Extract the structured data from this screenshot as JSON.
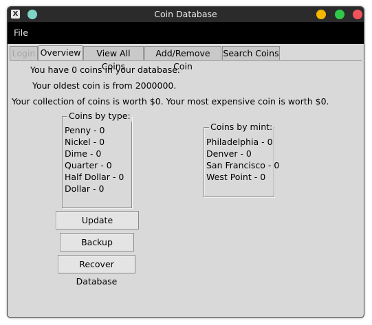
{
  "window": {
    "title": "Coin Database",
    "app_icon": "x-app-icon",
    "controls": {
      "minimize_color": "#f5b800",
      "maximize_color": "#2fc84a",
      "close_color": "#f0525c"
    }
  },
  "menu": {
    "file": "File"
  },
  "tabs": [
    {
      "label": "Login",
      "state": "disabled"
    },
    {
      "label": "Overview",
      "state": "active"
    },
    {
      "label": "View All Coins",
      "state": "normal"
    },
    {
      "label": "Add/Remove Coin",
      "state": "normal"
    },
    {
      "label": "Search Coins",
      "state": "normal"
    }
  ],
  "overview": {
    "count_text": "You have 0 coins in your database.",
    "oldest_text": "Your oldest coin is from 2000000.",
    "worth_text": "Your collection of coins is worth $0. Your most expensive coin is worth $0."
  },
  "by_type": {
    "title": "Coins by type:",
    "items": [
      "Penny - 0",
      "Nickel - 0",
      "Dime - 0",
      "Quarter - 0",
      "Half Dollar - 0",
      "Dollar - 0"
    ]
  },
  "by_mint": {
    "title": "Coins by mint:",
    "items": [
      "Philadelphia - 0",
      "Denver - 0",
      "San Francisco - 0",
      "West Point - 0"
    ]
  },
  "buttons": {
    "update": "Update Information",
    "backup": "Backup Database",
    "recover": "Recover Database"
  }
}
